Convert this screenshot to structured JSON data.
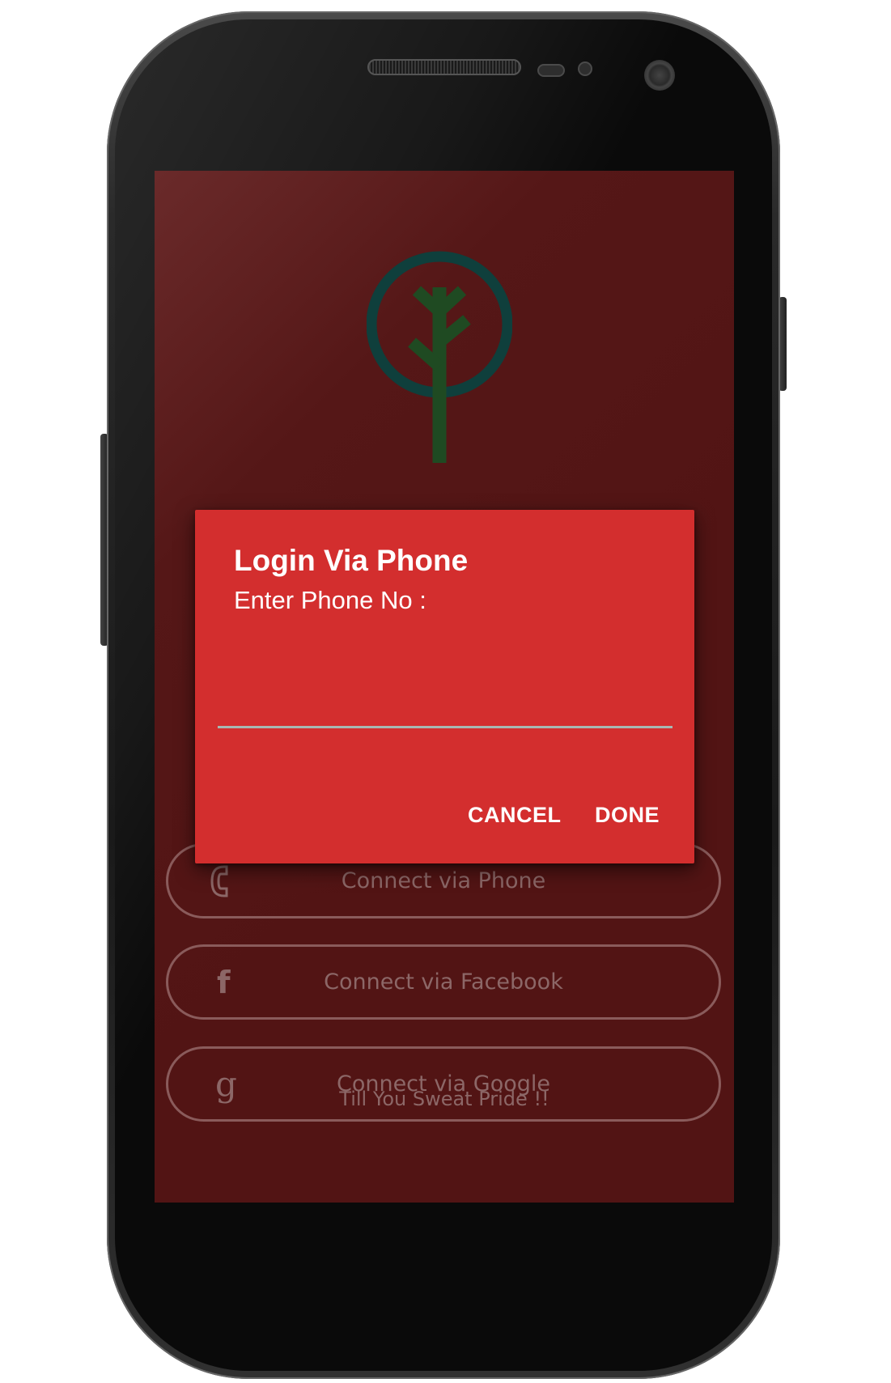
{
  "screen": {
    "background": "#521414",
    "logo": {
      "icon": "tree-in-circle-logo",
      "ring_color": "#0f3f3c",
      "tree_color": "#1f4a22"
    }
  },
  "connect_buttons": [
    {
      "icon": "phone-icon",
      "glyph": "",
      "label": "Connect via Phone"
    },
    {
      "icon": "facebook-icon",
      "glyph": "f",
      "label": "Connect via Facebook"
    },
    {
      "icon": "google-icon",
      "glyph": "g",
      "label": "Connect via Google"
    }
  ],
  "tagline": "Till You Sweat Pride !!",
  "dialog": {
    "background": "#d32e2e",
    "title": "Login Via Phone",
    "message": "Enter Phone No :",
    "phone_input": {
      "value": "",
      "placeholder": ""
    },
    "actions": {
      "cancel_label": "CANCEL",
      "done_label": "DONE"
    }
  }
}
